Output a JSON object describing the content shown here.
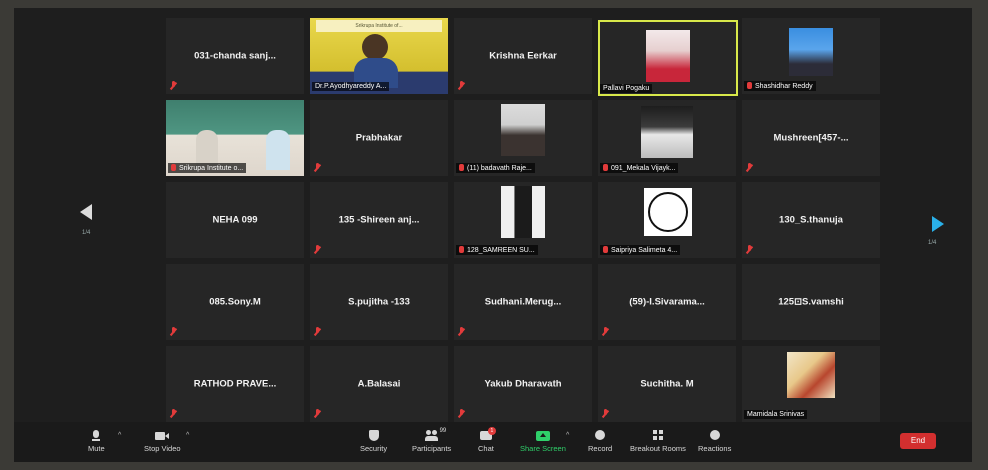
{
  "tiles": [
    {
      "name": "031-chanda sanj..."
    },
    {
      "label": "Dr.P.Ayodhyareddy A...",
      "banner": "Srikrupa Institute of..."
    },
    {
      "name": "Krishna Eerkar"
    },
    {
      "label": "Pallavi Pogaku"
    },
    {
      "label": "Shashidhar Reddy"
    },
    {
      "label": "Srikrupa Institute o..."
    },
    {
      "name": "Prabhakar"
    },
    {
      "label": "(11) badavath Raje..."
    },
    {
      "label": "091_Mekala Vijayk..."
    },
    {
      "name": "Mushreen[457-..."
    },
    {
      "name": "NEHA 099"
    },
    {
      "name": "135 -Shireen anj..."
    },
    {
      "label": "128_SAMREEN SU..."
    },
    {
      "label": "Saipriya Salimeta 4..."
    },
    {
      "name": "130_S.thanuja"
    },
    {
      "name": "085.Sony.M"
    },
    {
      "name": "S.pujitha -133"
    },
    {
      "name": "Sudhani.Merug..."
    },
    {
      "name": "(59)-I.Sivarama..."
    },
    {
      "name": "125⊡S.vamshi"
    },
    {
      "name": "RATHOD PRAVE..."
    },
    {
      "name": "A.Balasai"
    },
    {
      "name": "Yakub Dharavath"
    },
    {
      "name": "Suchitha. M"
    },
    {
      "label": "Mamidala Srinivas"
    }
  ],
  "pager": {
    "left": "1/4",
    "right": "1/4"
  },
  "toolbar": {
    "mute": "Mute",
    "stop_video": "Stop Video",
    "security": "Security",
    "participants": "Participants",
    "participants_count": "99",
    "chat": "Chat",
    "chat_badge": "1",
    "share_screen": "Share Screen",
    "record": "Record",
    "breakout": "Breakout Rooms",
    "reactions": "Reactions",
    "end": "End"
  },
  "colors": {
    "tile": "#262626",
    "share": "#2fd06a",
    "end": "#d32f2f",
    "active_border": "#d8e84a",
    "muted": "#e23b3b"
  }
}
